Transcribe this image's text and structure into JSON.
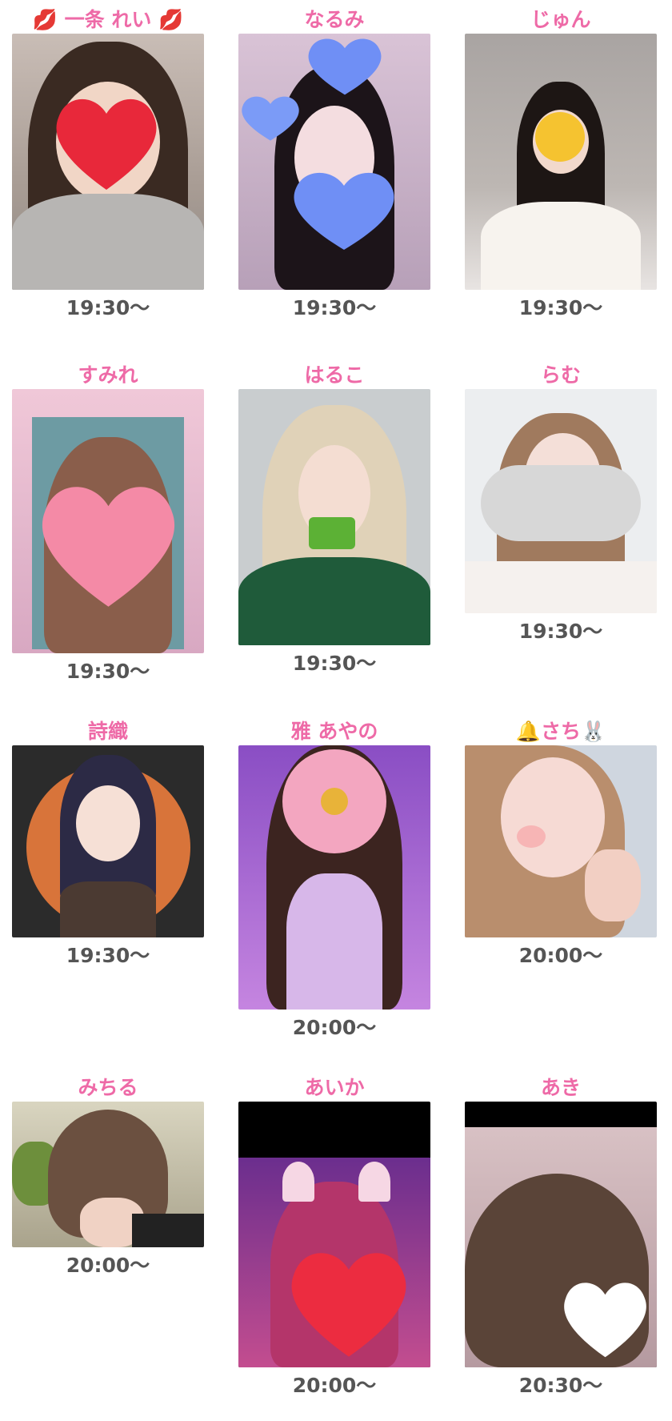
{
  "accent_color": "#ee6aa7",
  "time_color": "#555555",
  "cards": [
    {
      "name": "💋 一条 れい 💋",
      "time": "19:30〜",
      "face_cover": "heart-icon",
      "cover_color": "#e8283a"
    },
    {
      "name": "なるみ",
      "time": "19:30〜",
      "face_cover": "blue-heart-icon",
      "cover_color": "#6f8ff5"
    },
    {
      "name": "じゅん",
      "time": "19:30〜",
      "face_cover": "kiss-emoji-icon",
      "cover_color": "#f5c330"
    },
    {
      "name": "すみれ",
      "time": "19:30〜",
      "face_cover": "pink-heart-icon",
      "cover_color": "#f48aa6"
    },
    {
      "name": "はるこ",
      "time": "19:30〜",
      "face_cover": "sticker-icon",
      "cover_color": "#5cb135"
    },
    {
      "name": "らむ",
      "time": "19:30〜",
      "face_cover": "cloud-icon",
      "cover_color": "#d7d7d7"
    },
    {
      "name": "詩織",
      "time": "19:30〜",
      "face_cover": "illustration",
      "cover_color": "#d8743a"
    },
    {
      "name": "雅 あやの",
      "time": "20:00〜",
      "face_cover": "flower-icon",
      "cover_color": "#f3a6c0"
    },
    {
      "name": "🔔さち🐰",
      "time": "20:00〜",
      "face_cover": "cat-face-filter",
      "cover_color": "#f7b5b5"
    },
    {
      "name": "みちる",
      "time": "20:00〜",
      "face_cover": "none",
      "cover_color": "#6b5040"
    },
    {
      "name": "あいか",
      "time": "20:00〜",
      "face_cover": "red-heart-icon",
      "cover_color": "#ec2c40"
    },
    {
      "name": "あき",
      "time": "20:30〜",
      "face_cover": "white-heart-icon",
      "cover_color": "#ffffff"
    }
  ]
}
